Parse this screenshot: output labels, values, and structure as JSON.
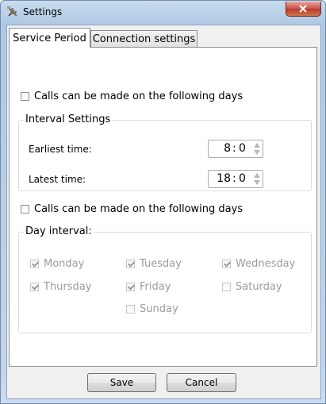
{
  "window": {
    "title": "Settings"
  },
  "tabs": [
    {
      "label": "Service Period",
      "active": true
    },
    {
      "label": "Connection settings",
      "active": false
    }
  ],
  "calls_days_checkbox_1": {
    "label": "Calls can be made on the following days",
    "checked": false
  },
  "interval_settings": {
    "title": "Interval Settings",
    "earliest": {
      "label": "Earliest time:",
      "hour": "8",
      "minute": "0"
    },
    "latest": {
      "label": "Latest time:",
      "hour": "18",
      "minute": "0"
    },
    "separator": ":"
  },
  "calls_days_checkbox_2": {
    "label": "Calls can be made on the following days",
    "checked": false
  },
  "day_interval": {
    "title": "Day interval:",
    "days": [
      {
        "label": "Monday",
        "checked": true
      },
      {
        "label": "Tuesday",
        "checked": true
      },
      {
        "label": "Wednesday",
        "checked": true
      },
      {
        "label": "Thursday",
        "checked": true
      },
      {
        "label": "Friday",
        "checked": true
      },
      {
        "label": "Saturday",
        "checked": false
      },
      {
        "label": "Sunday",
        "checked": false
      }
    ]
  },
  "buttons": {
    "save": "Save",
    "cancel": "Cancel"
  }
}
